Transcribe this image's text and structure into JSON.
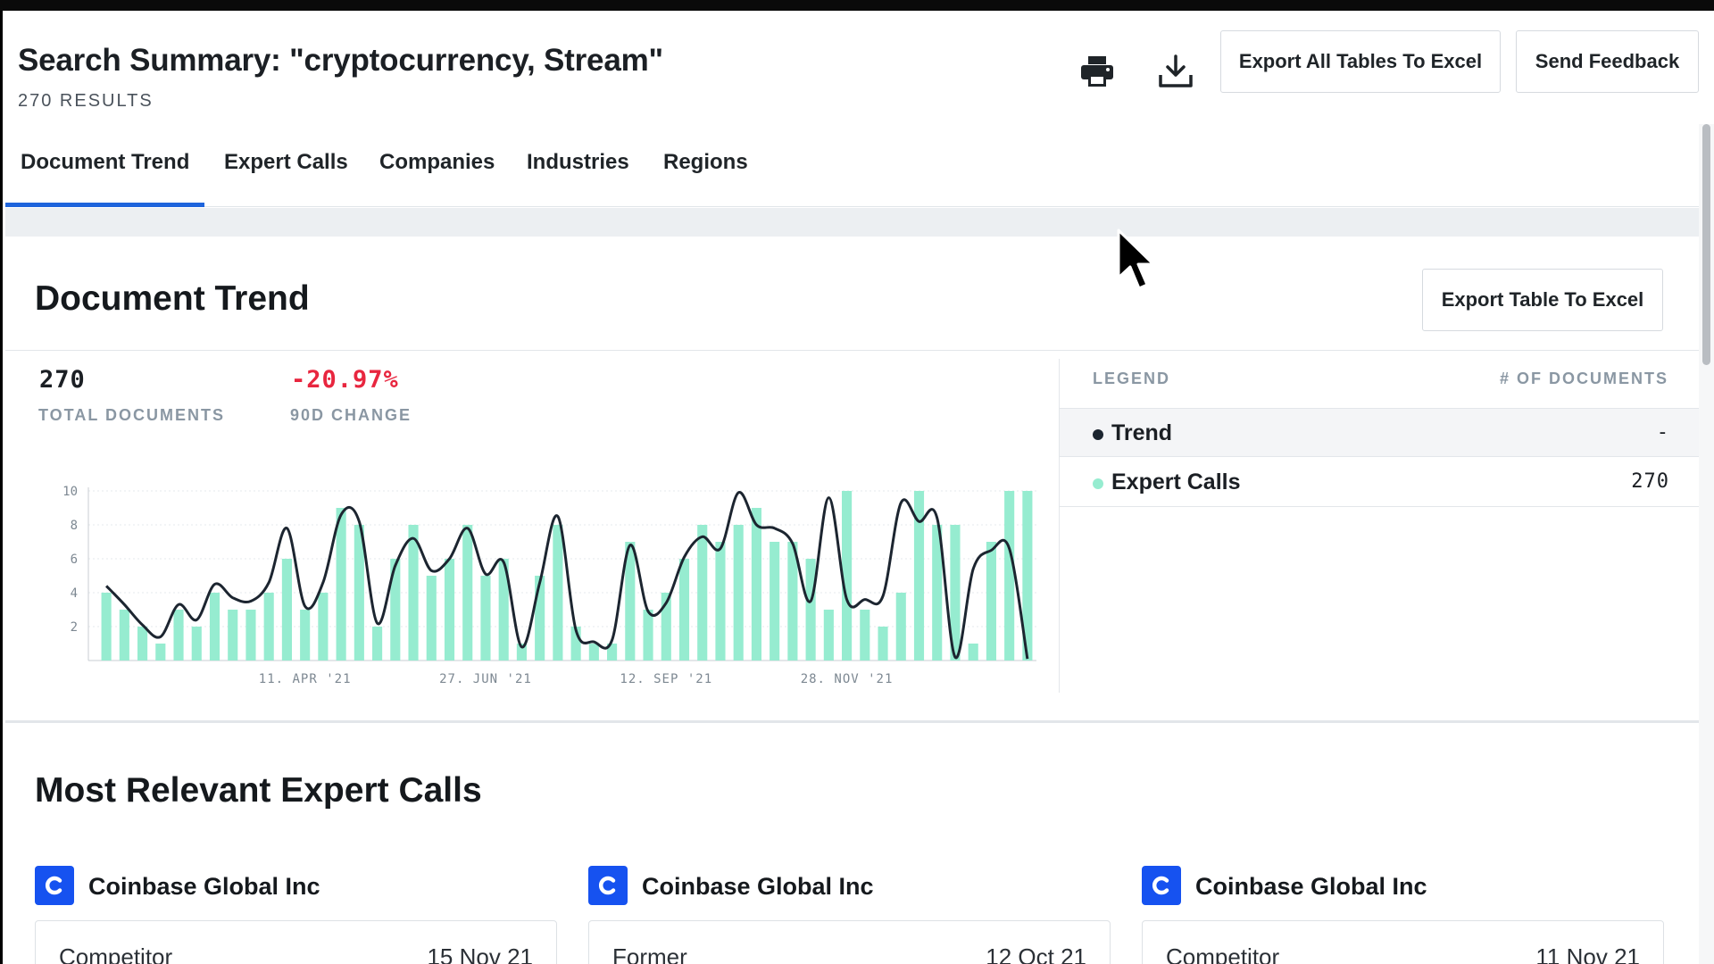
{
  "header": {
    "title": "Search Summary: \"cryptocurrency, Stream\"",
    "results": "270 RESULTS",
    "print_icon": "printer-icon",
    "download_icon": "download-icon",
    "export_all_label": "Export All Tables To Excel",
    "feedback_label": "Send Feedback"
  },
  "tabs": [
    {
      "label": "Document Trend",
      "active": true
    },
    {
      "label": "Expert Calls",
      "active": false
    },
    {
      "label": "Companies",
      "active": false
    },
    {
      "label": "Industries",
      "active": false
    },
    {
      "label": "Regions",
      "active": false
    }
  ],
  "trend": {
    "title": "Document Trend",
    "export_label": "Export Table To Excel",
    "total_value": "270",
    "total_label": "TOTAL DOCUMENTS",
    "change_value": "-20.97%",
    "change_label": "90D CHANGE",
    "change_color": "#e8263f",
    "legend": {
      "header_left": "LEGEND",
      "header_right": "# OF DOCUMENTS",
      "rows": [
        {
          "name": "Trend",
          "value": "-",
          "color": "#1c2530"
        },
        {
          "name": "Expert Calls",
          "value": "270",
          "color": "#96ecd0"
        }
      ]
    }
  },
  "chart_data": {
    "type": "bar",
    "bar_color": "#96ecd0",
    "line_color": "#1c2530",
    "ylim": [
      0,
      10
    ],
    "yticks": [
      2,
      4,
      6,
      8,
      10
    ],
    "xticks": [
      "11. APR '21",
      "27. JUN '21",
      "12. SEP '21",
      "28. NOV '21"
    ],
    "grid": true,
    "series": [
      {
        "type": "bar",
        "values": [
          4,
          3,
          2,
          1,
          3,
          2,
          4,
          3,
          3,
          4,
          6,
          3,
          4,
          9,
          8,
          2,
          6,
          8,
          5,
          6,
          8,
          5,
          6,
          1,
          5,
          8,
          2,
          1,
          1,
          7,
          3,
          4,
          6,
          8,
          7,
          8,
          9,
          7,
          7,
          6,
          3,
          10,
          3,
          2,
          4,
          10,
          8,
          8,
          1,
          7,
          10,
          10
        ]
      },
      {
        "type": "line",
        "values": [
          4.4,
          3.3,
          2.1,
          1.4,
          3.3,
          2.4,
          4.5,
          3.7,
          3.5,
          4.6,
          7.8,
          3.2,
          4.6,
          8.6,
          8.2,
          2.2,
          5.6,
          7.2,
          5.3,
          6.0,
          7.8,
          5.1,
          5.8,
          0.8,
          4.6,
          8.5,
          1.8,
          1.1,
          1.2,
          6.8,
          2.9,
          3.4,
          6.1,
          7.3,
          6.6,
          9.9,
          8.0,
          7.8,
          6.9,
          3.5,
          9.6,
          3.6,
          3.6,
          3.8,
          9.3,
          8.2,
          8.4,
          0.2,
          5.4,
          6.5,
          6.6,
          0.1
        ]
      }
    ]
  },
  "expert_calls": {
    "title": "Most Relevant Expert Calls",
    "cards": [
      {
        "company": "Coinbase Global Inc",
        "type": "Competitor",
        "date": "15 Nov 21"
      },
      {
        "company": "Coinbase Global Inc",
        "type": "Former",
        "date": "12 Oct 21"
      },
      {
        "company": "Coinbase Global Inc",
        "type": "Competitor",
        "date": "11 Nov 21"
      }
    ]
  }
}
